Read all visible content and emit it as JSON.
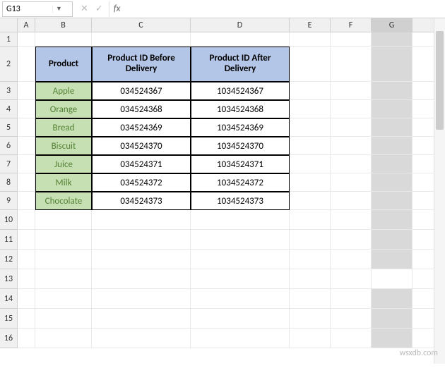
{
  "formula_bar": {
    "name_box_value": "G13",
    "cancel": "✕",
    "confirm": "✓",
    "fx": "fx"
  },
  "columns": [
    "A",
    "B",
    "C",
    "D",
    "E",
    "F",
    "G"
  ],
  "rows": [
    "1",
    "2",
    "3",
    "4",
    "5",
    "6",
    "7",
    "8",
    "9",
    "10",
    "11",
    "12",
    "13",
    "14",
    "15",
    "16"
  ],
  "selected_column": "G",
  "active_row": "13",
  "headers": {
    "product": "Product",
    "before": "Product ID Before Delivery",
    "after": "Product ID After Delivery"
  },
  "table": [
    {
      "product": "Apple",
      "before": "034524367",
      "after": "1034524367"
    },
    {
      "product": "Orange",
      "before": "034524368",
      "after": "1034524368"
    },
    {
      "product": "Bread",
      "before": "034524369",
      "after": "1034524369"
    },
    {
      "product": "Biscuit",
      "before": "034524370",
      "after": "1034524370"
    },
    {
      "product": "Juice",
      "before": "034524371",
      "after": "1034524371"
    },
    {
      "product": "Milk",
      "before": "034524372",
      "after": "1034524372"
    },
    {
      "product": "Chocolate",
      "before": "034524373",
      "after": "1034524373"
    }
  ],
  "watermark": "wsxdb.com",
  "chart_data": {
    "type": "table",
    "columns": [
      "Product",
      "Product ID Before Delivery",
      "Product ID After Delivery"
    ],
    "rows": [
      [
        "Apple",
        "034524367",
        "1034524367"
      ],
      [
        "Orange",
        "034524368",
        "1034524368"
      ],
      [
        "Bread",
        "034524369",
        "1034524369"
      ],
      [
        "Biscuit",
        "034524370",
        "1034524370"
      ],
      [
        "Juice",
        "034524371",
        "1034524371"
      ],
      [
        "Milk",
        "034524372",
        "1034524372"
      ],
      [
        "Chocolate",
        "034524373",
        "1034524373"
      ]
    ]
  }
}
